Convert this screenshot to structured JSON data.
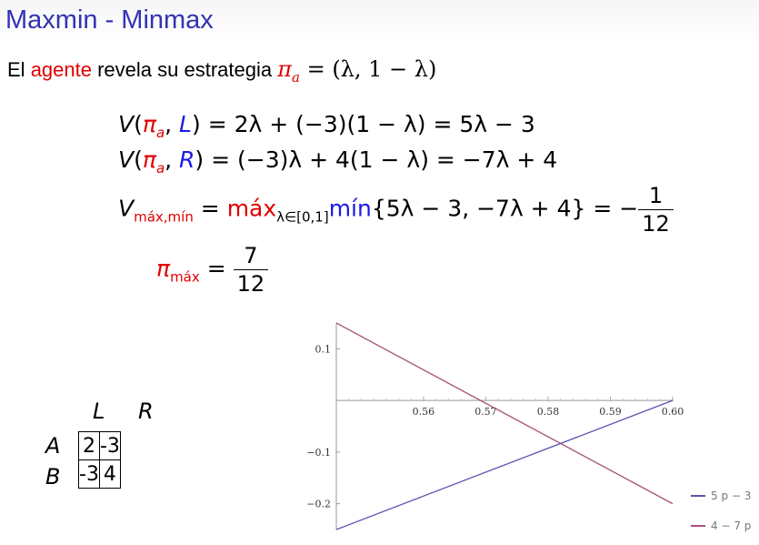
{
  "slide": {
    "title": "Maxmin - Minmax",
    "intro_prefix": "El ",
    "intro_agent": "agente",
    "intro_suffix": " revela su estrategia "
  },
  "equations": {
    "v_l_rhs": "= 2λ + (−3)(1 − λ) = 5λ − 3",
    "v_r_rhs": "= (−3)λ + 4(1 − λ) = −7λ + 4",
    "vmaxmin_sub": "máx,mín",
    "vmaxmin_max": "máx",
    "vmaxmin_max_sub": "λ∈[0,1]",
    "vmaxmin_min": "mín",
    "vmaxmin_rest": "{5λ − 3, −7λ + 4} = −",
    "vmaxmin_num": "1",
    "vmaxmin_den": "12",
    "pimax_sub": "máx",
    "pimax_num": "7",
    "pimax_den": "12"
  },
  "game_table": {
    "columns": [
      "L",
      "R"
    ],
    "rows": [
      "A",
      "B"
    ],
    "cells": [
      [
        "2",
        "-3"
      ],
      [
        "-3",
        "4"
      ]
    ]
  },
  "chart_data": {
    "type": "line",
    "x_range": [
      0.546,
      0.6
    ],
    "y_range": [
      -0.25,
      0.15
    ],
    "x_ticks": [
      "0.56",
      "0.57",
      "0.58",
      "0.59",
      "0.60"
    ],
    "y_ticks": [
      "0.1",
      "-0.1",
      "-0.2"
    ],
    "series": [
      {
        "name": "5 p − 3",
        "color": "#5a55b0",
        "points": [
          [
            0.546,
            -0.25
          ],
          [
            0.6,
            0.0
          ]
        ]
      },
      {
        "name": "4 − 7 p",
        "color": "#a8507a",
        "points": [
          [
            0.546,
            0.15
          ],
          [
            0.6,
            -0.2
          ]
        ]
      }
    ],
    "legend_position": "bottom-right"
  }
}
